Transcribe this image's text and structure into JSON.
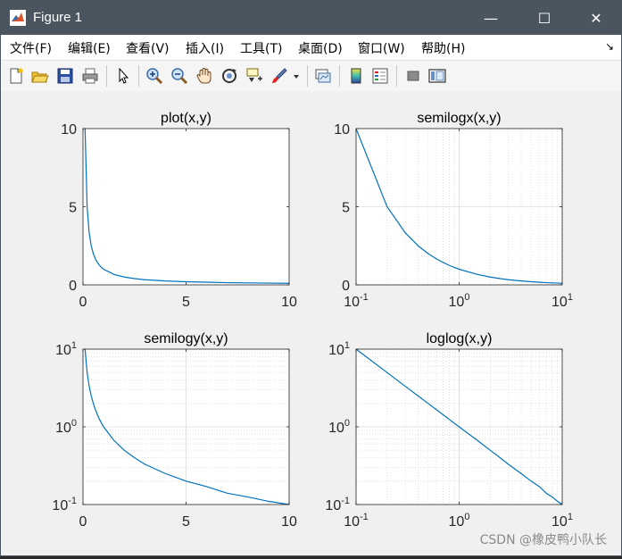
{
  "window": {
    "title": "Figure 1",
    "controls": {
      "minimize": "—",
      "maximize": "☐",
      "close": "✕"
    }
  },
  "menu": {
    "items": [
      "文件(F)",
      "编辑(E)",
      "查看(V)",
      "插入(I)",
      "工具(T)",
      "桌面(D)",
      "窗口(W)",
      "帮助(H)"
    ],
    "overflow_icon": "dock-arrow-icon"
  },
  "toolbar": {
    "buttons": [
      "new-figure-icon",
      "open-file-icon",
      "save-icon",
      "print-icon",
      "edit-pointer-icon",
      "zoom-in-icon",
      "zoom-out-icon",
      "pan-hand-icon",
      "rotate-3d-icon",
      "data-cursor-icon",
      "brush-icon",
      "brush-dropdown-icon",
      "link-plot-icon",
      "colorbar-icon",
      "legend-icon",
      "hide-plot-tools-icon",
      "show-plot-tools-icon"
    ]
  },
  "watermark": "CSDN @橡皮鸭小队长",
  "chart_data": [
    {
      "type": "line",
      "title": "plot(x,y)",
      "x": [
        0.1,
        0.2,
        0.3,
        0.4,
        0.5,
        0.6,
        0.7,
        0.8,
        0.9,
        1,
        1.5,
        2,
        2.5,
        3,
        4,
        5,
        6,
        7,
        8,
        9,
        10
      ],
      "y": [
        10,
        5,
        3.33,
        2.5,
        2,
        1.67,
        1.43,
        1.25,
        1.11,
        1,
        0.67,
        0.5,
        0.4,
        0.33,
        0.25,
        0.2,
        0.17,
        0.14,
        0.125,
        0.11,
        0.1
      ],
      "xscale": "linear",
      "yscale": "linear",
      "xlim": [
        0,
        10
      ],
      "ylim": [
        0,
        10
      ],
      "xticks": [
        0,
        5,
        10
      ],
      "xtick_labels": [
        "0",
        "5",
        "10"
      ],
      "yticks": [
        0,
        5,
        10
      ],
      "ytick_labels": [
        "0",
        "5",
        "10"
      ],
      "grid": false,
      "line_color": "#0072bd"
    },
    {
      "type": "line",
      "title": "semilogx(x,y)",
      "x": [
        0.1,
        0.2,
        0.3,
        0.4,
        0.5,
        0.6,
        0.7,
        0.8,
        0.9,
        1,
        1.5,
        2,
        2.5,
        3,
        4,
        5,
        6,
        7,
        8,
        9,
        10
      ],
      "y": [
        10,
        5,
        3.33,
        2.5,
        2,
        1.67,
        1.43,
        1.25,
        1.11,
        1,
        0.67,
        0.5,
        0.4,
        0.33,
        0.25,
        0.2,
        0.17,
        0.14,
        0.125,
        0.11,
        0.1
      ],
      "xscale": "log",
      "yscale": "linear",
      "xlim": [
        0.1,
        10
      ],
      "ylim": [
        0,
        10
      ],
      "xticks": [
        0.1,
        1,
        10
      ],
      "xtick_labels": [
        {
          "base": "10",
          "exp": "-1"
        },
        {
          "base": "10",
          "exp": "0"
        },
        {
          "base": "10",
          "exp": "1"
        }
      ],
      "yticks": [
        0,
        5,
        10
      ],
      "ytick_labels": [
        "0",
        "5",
        "10"
      ],
      "grid": true,
      "line_color": "#0072bd"
    },
    {
      "type": "line",
      "title": "semilogy(x,y)",
      "x": [
        0.1,
        0.2,
        0.3,
        0.4,
        0.5,
        0.6,
        0.7,
        0.8,
        0.9,
        1,
        1.5,
        2,
        2.5,
        3,
        4,
        5,
        6,
        7,
        8,
        9,
        10
      ],
      "y": [
        10,
        5,
        3.33,
        2.5,
        2,
        1.67,
        1.43,
        1.25,
        1.11,
        1,
        0.67,
        0.5,
        0.4,
        0.33,
        0.25,
        0.2,
        0.17,
        0.14,
        0.125,
        0.11,
        0.1
      ],
      "xscale": "linear",
      "yscale": "log",
      "xlim": [
        0,
        10
      ],
      "ylim": [
        0.1,
        10
      ],
      "xticks": [
        0,
        5,
        10
      ],
      "xtick_labels": [
        "0",
        "5",
        "10"
      ],
      "yticks": [
        0.1,
        1,
        10
      ],
      "ytick_labels": [
        {
          "base": "10",
          "exp": "-1"
        },
        {
          "base": "10",
          "exp": "0"
        },
        {
          "base": "10",
          "exp": "1"
        }
      ],
      "grid": true,
      "line_color": "#0072bd"
    },
    {
      "type": "line",
      "title": "loglog(x,y)",
      "x": [
        0.1,
        0.2,
        0.3,
        0.4,
        0.5,
        0.6,
        0.7,
        0.8,
        0.9,
        1,
        1.5,
        2,
        2.5,
        3,
        4,
        5,
        6,
        7,
        8,
        9,
        10
      ],
      "y": [
        10,
        5,
        3.33,
        2.5,
        2,
        1.67,
        1.43,
        1.25,
        1.11,
        1,
        0.67,
        0.5,
        0.4,
        0.33,
        0.25,
        0.2,
        0.17,
        0.14,
        0.125,
        0.11,
        0.1
      ],
      "xscale": "log",
      "yscale": "log",
      "xlim": [
        0.1,
        10
      ],
      "ylim": [
        0.1,
        10
      ],
      "xticks": [
        0.1,
        1,
        10
      ],
      "xtick_labels": [
        {
          "base": "10",
          "exp": "-1"
        },
        {
          "base": "10",
          "exp": "0"
        },
        {
          "base": "10",
          "exp": "1"
        }
      ],
      "yticks": [
        0.1,
        1,
        10
      ],
      "ytick_labels": [
        {
          "base": "10",
          "exp": "-1"
        },
        {
          "base": "10",
          "exp": "0"
        },
        {
          "base": "10",
          "exp": "1"
        }
      ],
      "grid": true,
      "line_color": "#0072bd"
    }
  ]
}
